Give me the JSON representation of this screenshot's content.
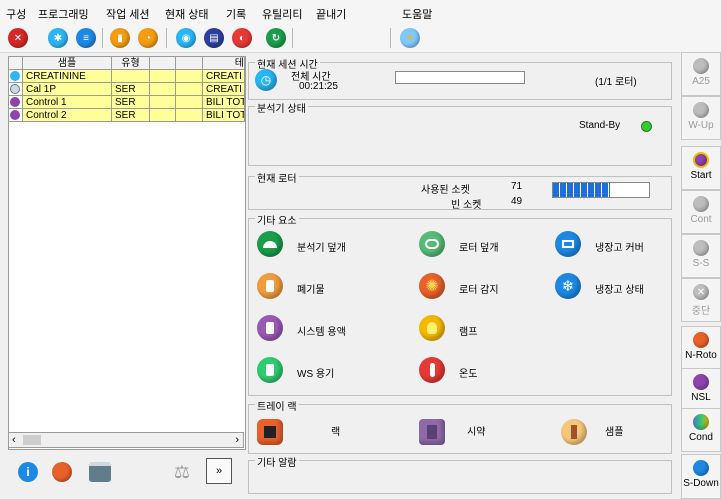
{
  "menu": [
    "구성",
    "프로그래밍",
    "작업 세션",
    "현재 상태",
    "기록",
    "유틸리티",
    "끝내기",
    "도움말"
  ],
  "toolbar_icons": [
    "stop-icon",
    "snowflake-icon",
    "list-icon",
    "control-icon",
    "calibration-icon",
    "camera-icon",
    "archive-icon",
    "alarm-icon",
    "refresh-icon",
    "sun-icon"
  ],
  "samples": {
    "headers": [
      "샘플",
      "유형",
      "",
      "",
      "테"
    ],
    "rows": [
      {
        "icon": "blue-status-icon",
        "name": "CREATININE",
        "type": "",
        "test": "CREATI"
      },
      {
        "icon": "gear-status-icon",
        "name": "Cal 1P",
        "type": "SER",
        "test": "CREATI"
      },
      {
        "icon": "purple-status-icon",
        "name": "Control 1",
        "type": "SER",
        "test": "BILI TOT"
      },
      {
        "icon": "purple-status-icon",
        "name": "Control 2",
        "type": "SER",
        "test": "BILI TOT"
      }
    ]
  },
  "bottom_buttons": {
    "more": "»"
  },
  "session": {
    "title": "현재 세션 시간",
    "total_label": "전체 시간",
    "total_time": "00:21:25",
    "rotor": "(1/1 로터)",
    "progress": 0
  },
  "analyzer": {
    "title": "분석기 상태",
    "status": "Stand-By",
    "status_color": "#33cc33"
  },
  "rotor": {
    "title": "현재 로터",
    "used_label": "사용된 소켓",
    "used": "71",
    "empty_label": "빈 소켓",
    "empty": "49",
    "fill": 0.59
  },
  "other": {
    "title": "기타 요소",
    "items": [
      {
        "icon": "analyzer-cover-icon",
        "label": "분석기 덮개",
        "color": "#22aa55"
      },
      {
        "icon": "rotor-cover-icon",
        "label": "로터 덮개",
        "color": "#55bb77"
      },
      {
        "icon": "fridge-cover-icon",
        "label": "냉장고 커버",
        "color": "#1e88e5"
      },
      {
        "icon": "waste-icon",
        "label": "폐기물",
        "color": "#f39c3c"
      },
      {
        "icon": "rotor-detect-icon",
        "label": "로터 감지",
        "color": "#e8602a"
      },
      {
        "icon": "fridge-status-icon",
        "label": "냉장고 상태",
        "color": "#1e88e5"
      },
      {
        "icon": "system-solution-icon",
        "label": "시스템 용액",
        "color": "#9b59b6"
      },
      {
        "icon": "lamp-icon",
        "label": "램프",
        "color": "#f5b800"
      },
      {
        "icon": "ws-container-icon",
        "label": "WS 용기",
        "color": "#2ecc71"
      },
      {
        "icon": "temperature-icon",
        "label": "온도",
        "color": "#e53935"
      }
    ]
  },
  "tray": {
    "title": "트레이 랙",
    "rack": "랙",
    "reagent": "시약",
    "sample": "샘플"
  },
  "alarm": {
    "title": "기타 알람"
  },
  "right_buttons": [
    {
      "label": "A25",
      "disabled": true,
      "color": "#9e9e9e"
    },
    {
      "label": "W-Up",
      "disabled": true,
      "color": "#9e9e9e"
    },
    {
      "label": "Start",
      "disabled": false,
      "color": "#8e44ad"
    },
    {
      "label": "Cont",
      "disabled": true,
      "color": "#9e9e9e"
    },
    {
      "label": "S-S",
      "disabled": true,
      "color": "#9e9e9e"
    },
    {
      "label": "중단",
      "disabled": true,
      "color": "#9e9e9e"
    },
    {
      "label": "N-Roto",
      "disabled": false,
      "color": "#e8602a"
    },
    {
      "label": "NSL",
      "disabled": false,
      "color": "#8e44ad"
    },
    {
      "label": "Cond",
      "disabled": false,
      "color": "#5b6fd1"
    },
    {
      "label": "S-Down",
      "disabled": false,
      "color": "#1e88e5"
    }
  ]
}
